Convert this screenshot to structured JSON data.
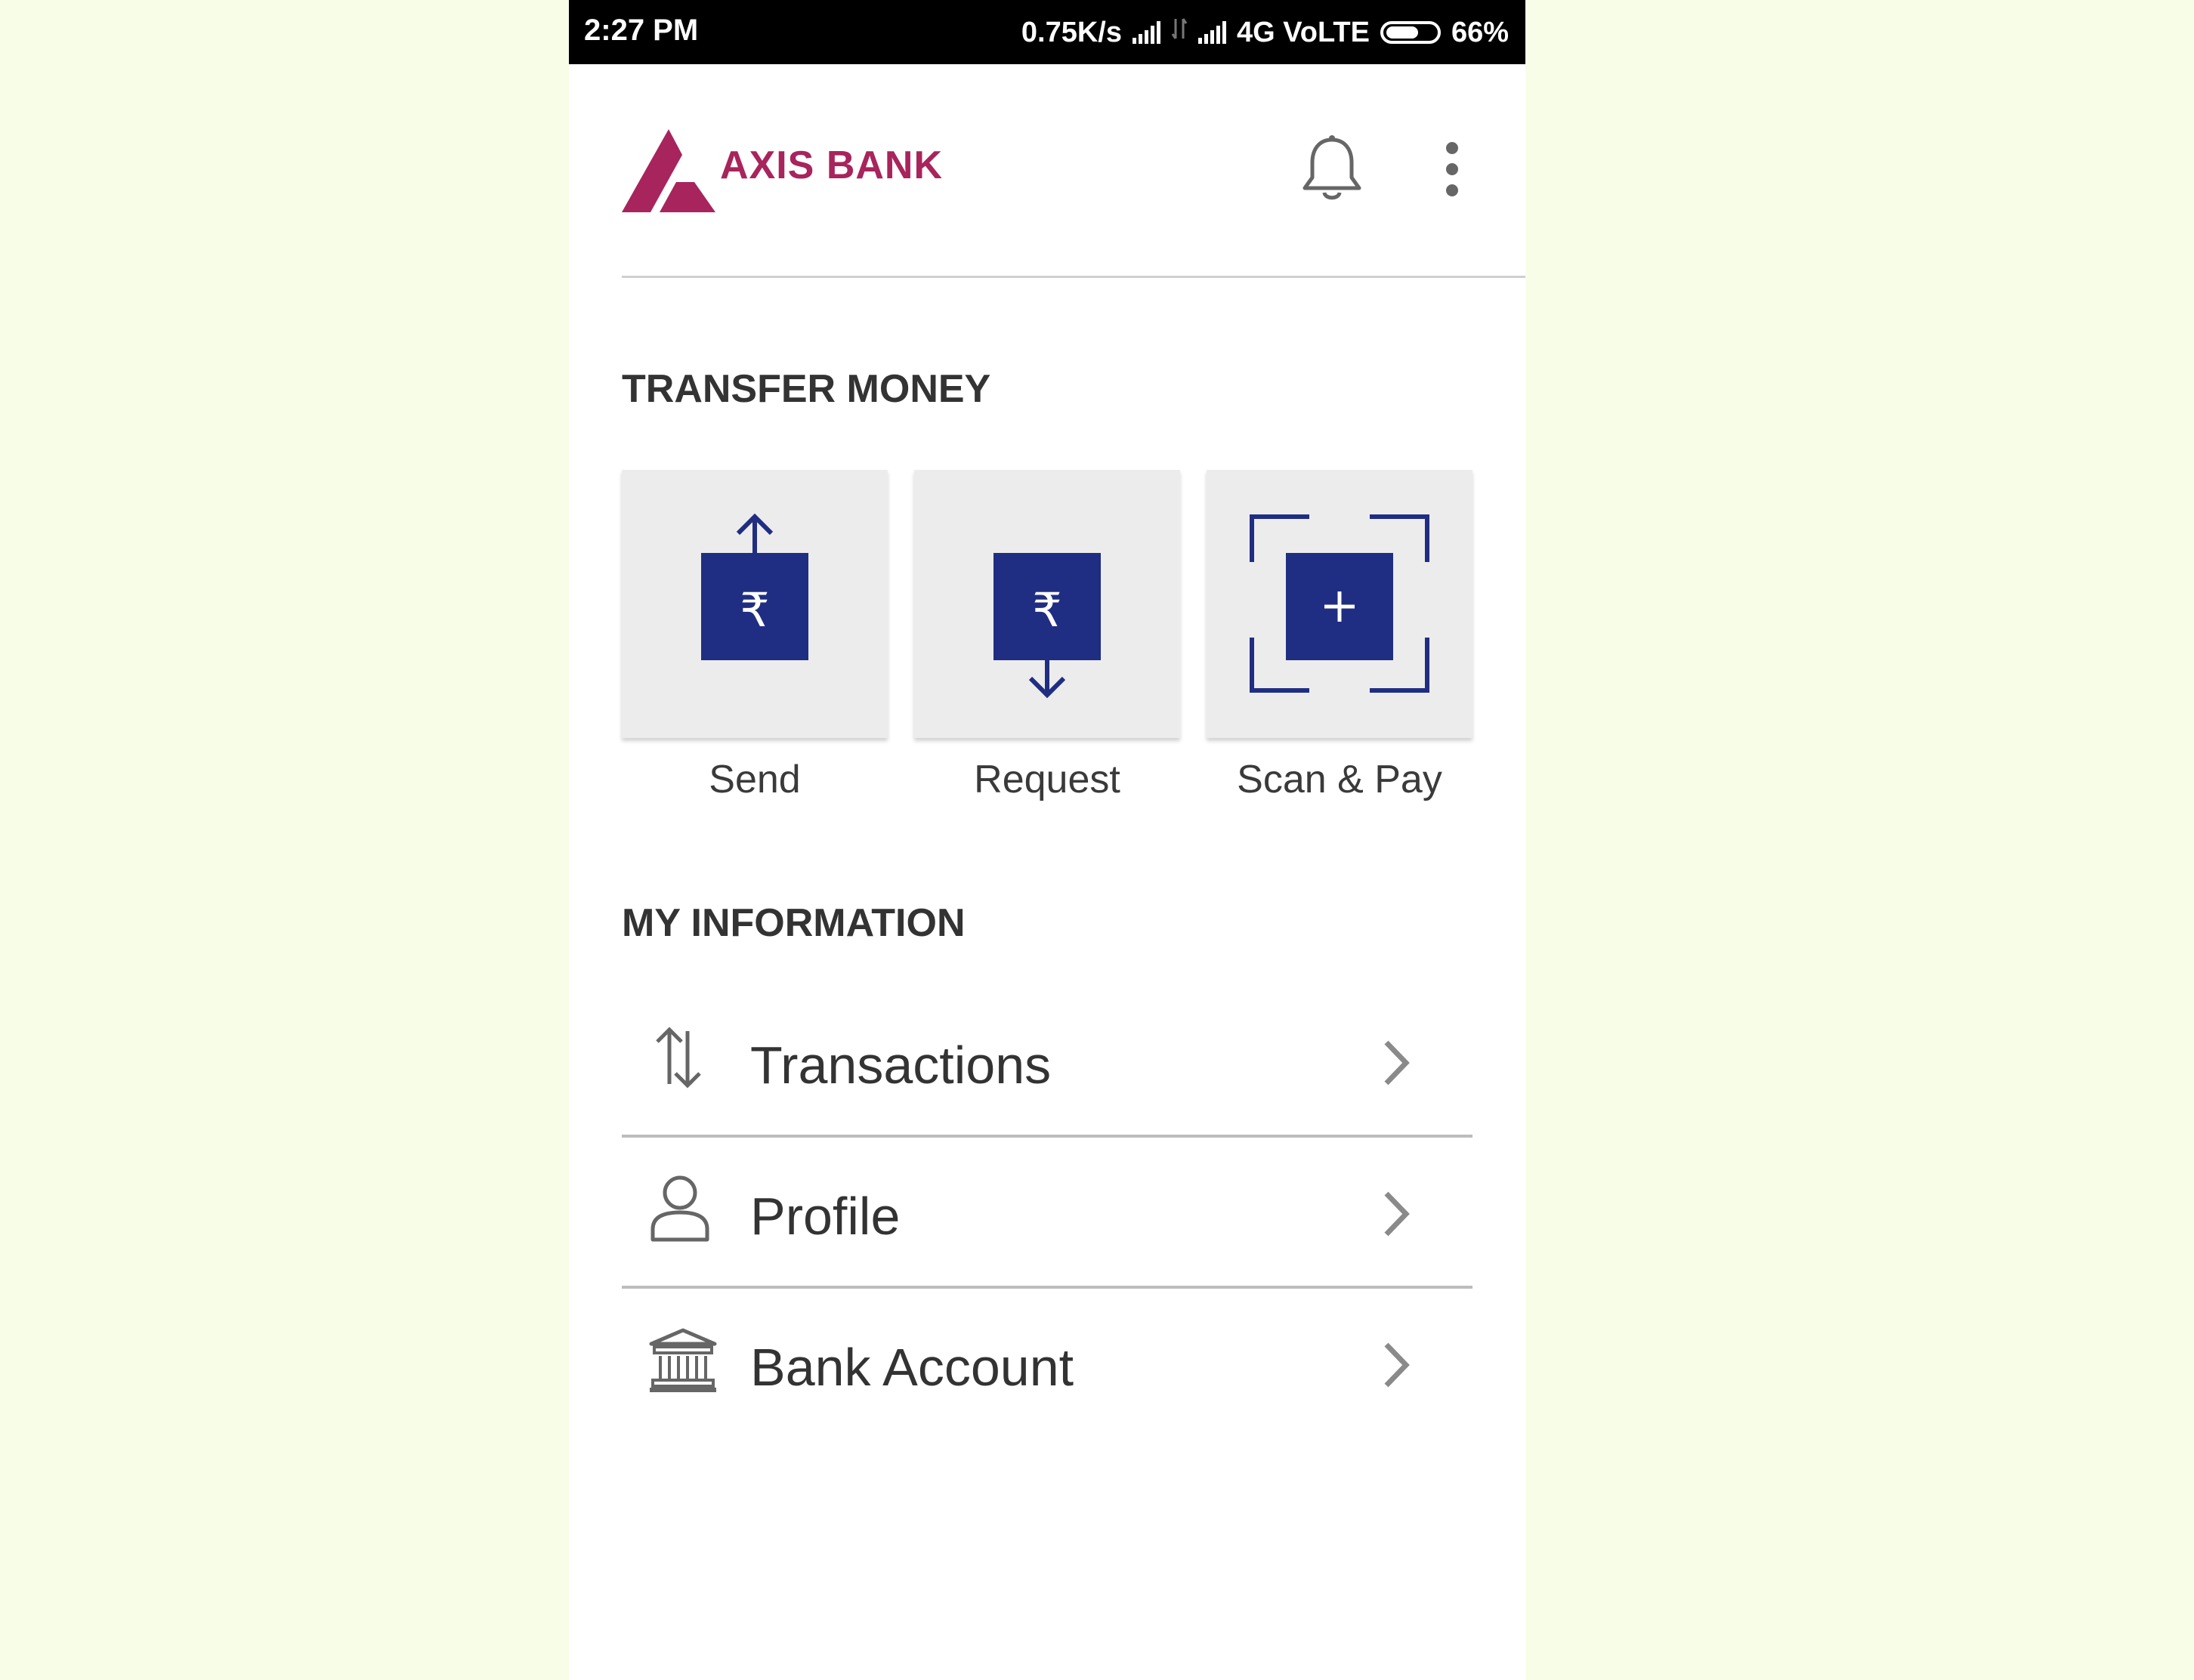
{
  "status_bar": {
    "time": "2:27 PM",
    "speed": "0.75K/s",
    "network": "4G VoLTE",
    "battery": "66%",
    "battery_level": 0.66
  },
  "header": {
    "brand": "AXIS BANK",
    "brand_color": "#a8245c",
    "icons": [
      "axis-logo-icon",
      "bell-icon",
      "more-vert-icon"
    ]
  },
  "transfer": {
    "title": "TRANSFER MONEY",
    "tiles": [
      {
        "label": "Send",
        "icon": "send-money-icon"
      },
      {
        "label": "Request",
        "icon": "request-money-icon"
      },
      {
        "label": "Scan & Pay",
        "icon": "scan-pay-icon"
      }
    ],
    "accent": "#1f2e82"
  },
  "info": {
    "title": "MY INFORMATION",
    "items": [
      {
        "label": "Transactions",
        "icon": "transactions-icon"
      },
      {
        "label": "Profile",
        "icon": "profile-icon"
      },
      {
        "label": "Bank Account",
        "icon": "bank-icon"
      }
    ]
  }
}
